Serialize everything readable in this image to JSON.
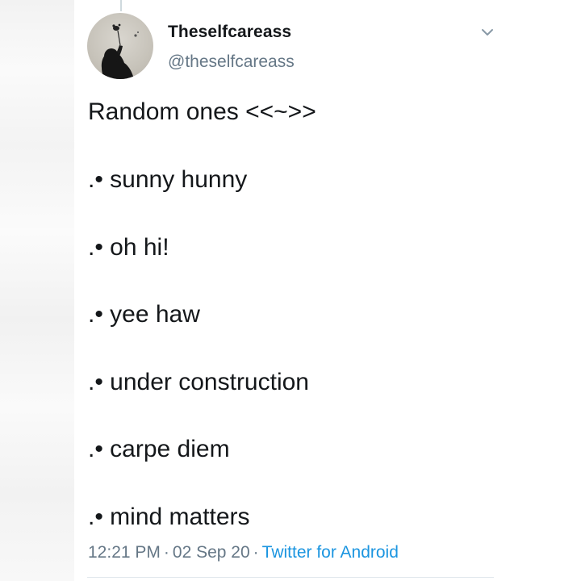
{
  "tweet": {
    "display_name": "Theselfcareass",
    "handle": "@theselfcareass",
    "avatar_icon": "profile-photo-silhouette",
    "menu_icon": "chevron-down-icon",
    "title": "Random ones <<~>>",
    "items": [
      ".• sunny hunny",
      ".• oh hi!",
      ".• yee haw",
      ".• under construction",
      ".• carpe diem",
      ".• mind matters"
    ],
    "time": "12:21 PM",
    "date": "02 Sep 20",
    "separator": "·",
    "source": "Twitter for Android"
  },
  "colors": {
    "text": "#14171a",
    "secondary": "#657786",
    "link": "#1b95e0",
    "divider": "#e1e8ed"
  }
}
